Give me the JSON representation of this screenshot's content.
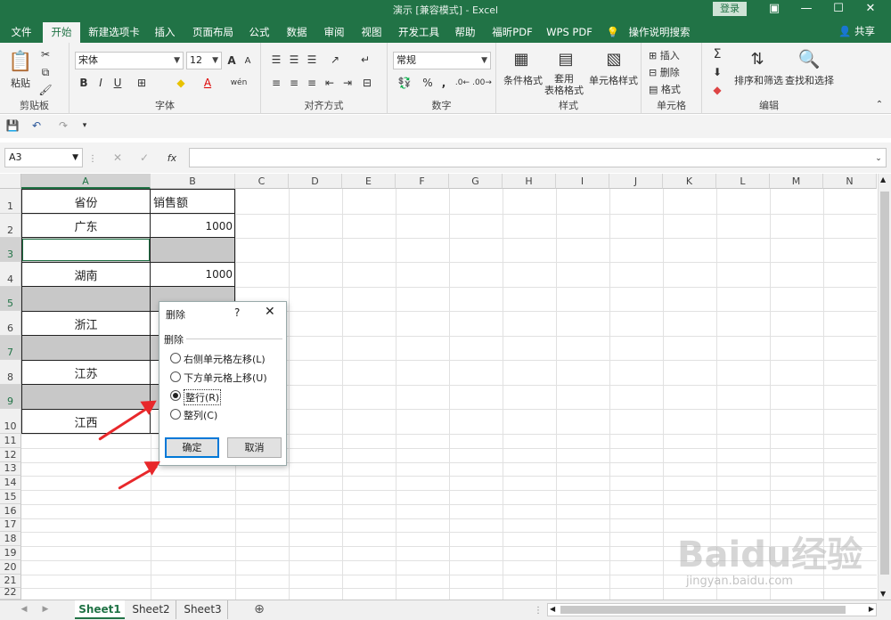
{
  "window": {
    "title": "演示  [兼容模式]  -  Excel",
    "login": "登录"
  },
  "menu": {
    "tabs": [
      "文件",
      "开始",
      "新建选项卡",
      "插入",
      "页面布局",
      "公式",
      "数据",
      "审阅",
      "视图",
      "开发工具",
      "帮助",
      "福昕PDF",
      "WPS PDF",
      "操作说明搜索"
    ],
    "active": "开始",
    "share": "共享"
  },
  "ribbon": {
    "clipboard": {
      "label": "剪贴板",
      "paste": "粘贴"
    },
    "font": {
      "label": "字体",
      "name": "宋体",
      "size": "12",
      "bold": "B",
      "italic": "I",
      "underline": "U",
      "grow": "A",
      "shrink": "A",
      "wen": "wén"
    },
    "align": {
      "label": "对齐方式"
    },
    "number": {
      "label": "数字",
      "format": "常规",
      "percent": "%",
      "comma": ","
    },
    "styles": {
      "label": "样式",
      "cond": "条件格式",
      "table": "套用\n表格格式",
      "cell": "单元格样式"
    },
    "cells": {
      "label": "单元格",
      "insert": "插入",
      "delete": "删除",
      "format": "格式"
    },
    "edit": {
      "label": "编辑",
      "sort": "排序和筛选",
      "find": "查找和选择"
    }
  },
  "formula_bar": {
    "name_box": "A3",
    "fx": "fx"
  },
  "grid": {
    "columns": [
      "A",
      "B",
      "C",
      "D",
      "E",
      "F",
      "G",
      "H",
      "I",
      "J",
      "K",
      "L",
      "M",
      "N"
    ],
    "rows": [
      "1",
      "2",
      "3",
      "4",
      "5",
      "6",
      "7",
      "8",
      "9",
      "10",
      "11",
      "12",
      "13",
      "14",
      "15",
      "16",
      "17",
      "18",
      "19",
      "20",
      "21",
      "22"
    ],
    "cells": {
      "A1": "省份",
      "B1": "销售额",
      "A2": "广东",
      "B2": "1000",
      "A4": "湖南",
      "B4": "1000",
      "A6": "浙江",
      "A8": "江苏",
      "A10": "江西"
    }
  },
  "dialog": {
    "title": "删除",
    "help": "?",
    "close": "✕",
    "group": "删除",
    "options": [
      "右侧单元格左移(L)",
      "下方单元格上移(U)",
      "整行(R)",
      "整列(C)"
    ],
    "selected_index": 2,
    "ok": "确定",
    "cancel": "取消"
  },
  "sheets": {
    "tabs": [
      "Sheet1",
      "Sheet2",
      "Sheet3"
    ],
    "active": "Sheet1",
    "add": "⊕"
  },
  "watermark": {
    "brand": "Baidu经验",
    "url": "jingyan.baidu.com"
  },
  "colors": {
    "accent": "#217346",
    "arrow": "#e8282b",
    "highlight_gray": "#c8c8c8"
  }
}
